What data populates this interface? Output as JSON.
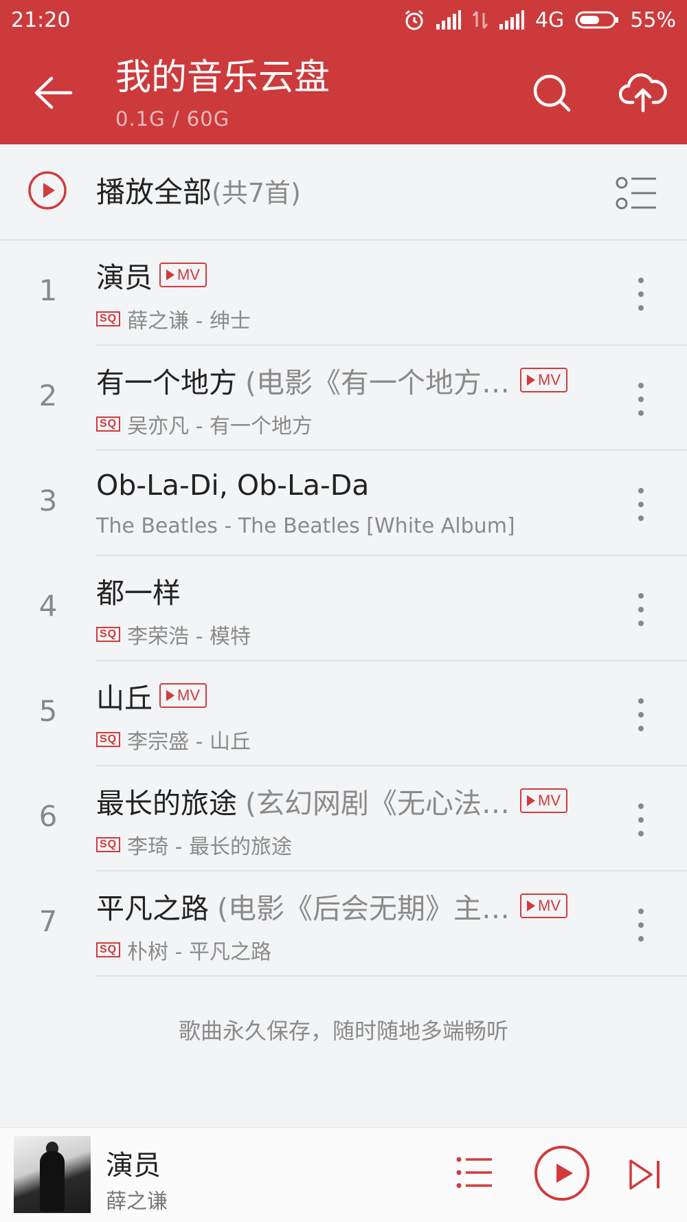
{
  "status_bar": {
    "time": "21:20",
    "network": "4G",
    "battery": "55%"
  },
  "header": {
    "title": "我的音乐云盘",
    "storage": "0.1G / 60G"
  },
  "play_all": {
    "label": "播放全部",
    "count": "(共7首)"
  },
  "songs": [
    {
      "num": "1",
      "title": "演员",
      "subtitle": "",
      "mv": "MV",
      "mv_inline": true,
      "sq": "SQ",
      "meta": "薛之谦 - 绅士"
    },
    {
      "num": "2",
      "title": "有一个地方",
      "subtitle": "(电影《有一个地方…",
      "mv": "MV",
      "mv_inline": false,
      "sq": "SQ",
      "meta": "吴亦凡 - 有一个地方"
    },
    {
      "num": "3",
      "title": "Ob-La-Di, Ob-La-Da",
      "subtitle": "",
      "mv": "",
      "sq": "",
      "meta": "The Beatles - The Beatles [White Album]"
    },
    {
      "num": "4",
      "title": "都一样",
      "subtitle": "",
      "mv": "",
      "sq": "SQ",
      "meta": "李荣浩 - 模特"
    },
    {
      "num": "5",
      "title": "山丘",
      "subtitle": "",
      "mv": "MV",
      "mv_inline": true,
      "sq": "SQ",
      "meta": "李宗盛 - 山丘"
    },
    {
      "num": "6",
      "title": "最长的旅途",
      "subtitle": "(玄幻网剧《无心法…",
      "mv": "MV",
      "mv_inline": false,
      "sq": "SQ",
      "meta": "李琦 - 最长的旅途"
    },
    {
      "num": "7",
      "title": "平凡之路",
      "subtitle": "(电影《后会无期》主…",
      "mv": "MV",
      "mv_inline": false,
      "sq": "SQ",
      "meta": "朴树 - 平凡之路"
    }
  ],
  "footer_note": "歌曲永久保存，随时随地多端畅听",
  "player": {
    "title": "演员",
    "artist": "薛之谦"
  },
  "icons": {
    "back": "arrow-left-icon",
    "search": "search-icon",
    "upload": "cloud-upload-icon",
    "play_all": "play-circle-icon",
    "list_mode": "list-select-icon",
    "more": "more-vertical-icon",
    "playlist": "playlist-icon",
    "play": "play-circle-icon",
    "next": "skip-next-icon"
  },
  "colors": {
    "brand_red": "#cd3a3c",
    "accent_red": "#d33a3c",
    "background": "#f3f4f6"
  }
}
